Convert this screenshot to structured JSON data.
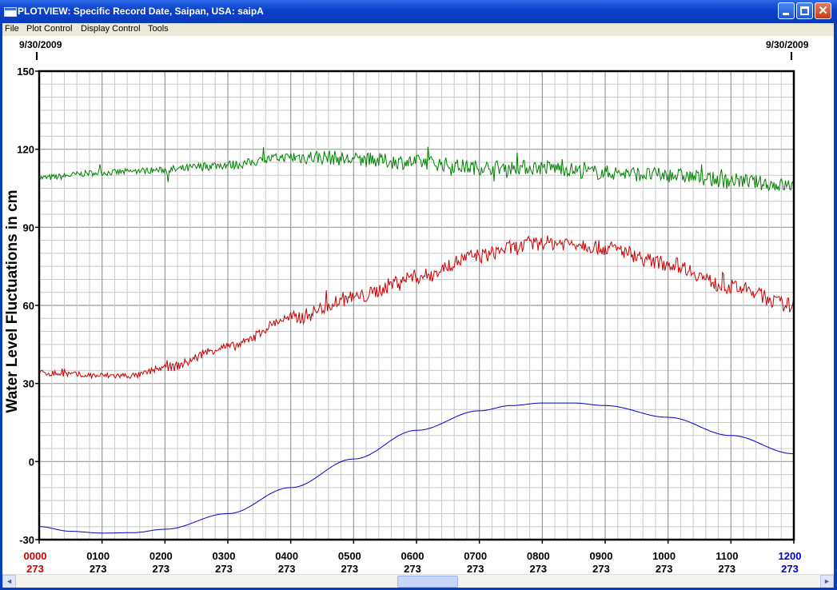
{
  "window": {
    "title": "PLOTVIEW: Specific Record Date, Saipan, USA: saipA",
    "buttons": {
      "minimize": "minimize-icon",
      "maximize": "maximize-icon",
      "close_glyph": "✕"
    }
  },
  "menu": {
    "items": [
      "File",
      "Plot Control",
      "Display Control",
      "Tools"
    ]
  },
  "plot": {
    "start_date": "9/30/2009",
    "end_date": "9/30/2009",
    "ylabel": "Water Level Fluctuations in cm"
  },
  "chart_data": {
    "type": "line",
    "ylabel": "Water Level Fluctuations in cm",
    "xlabel": "",
    "ylim": [
      -30,
      150
    ],
    "yticks": [
      -30,
      0,
      30,
      60,
      90,
      120,
      150
    ],
    "xlim": [
      0,
      12
    ],
    "xtick_labels": [
      "0000",
      "0100",
      "0200",
      "0300",
      "0400",
      "0500",
      "0600",
      "0700",
      "0800",
      "0900",
      "1000",
      "1100",
      "1200"
    ],
    "xtick_day": [
      "273",
      "273",
      "273",
      "273",
      "273",
      "273",
      "273",
      "273",
      "273",
      "273",
      "273",
      "273",
      "273"
    ],
    "xtick_colors": {
      "first": "#cc0000",
      "last": "#0000cc",
      "default": "#000000"
    },
    "grid": true,
    "series": [
      {
        "color": "#008000",
        "noise": 2.2,
        "x": [
          0,
          1,
          2,
          3,
          4,
          4.5,
          5,
          6,
          7,
          8,
          9,
          10,
          11,
          12
        ],
        "y": [
          109,
          111,
          112,
          114,
          117,
          117,
          116,
          115,
          113,
          113,
          111,
          110,
          108,
          106
        ]
      },
      {
        "color": "#cc0000",
        "noise": 2.2,
        "x": [
          0,
          1,
          1.5,
          2,
          3,
          4,
          5,
          6,
          7,
          7.5,
          8,
          8.5,
          9,
          10,
          11,
          12
        ],
        "y": [
          34,
          33,
          33,
          36,
          44,
          55,
          63,
          71,
          79,
          82,
          84,
          84,
          82,
          76,
          67,
          60
        ]
      },
      {
        "color": "#0000cc",
        "noise": 0,
        "x": [
          0,
          0.5,
          1,
          1.5,
          2,
          3,
          4,
          5,
          6,
          7,
          7.5,
          8,
          8.5,
          9,
          10,
          11,
          12
        ],
        "y": [
          -25,
          -26.8,
          -27.5,
          -27.3,
          -26,
          -20,
          -10,
          1,
          12,
          19.5,
          21.5,
          22.5,
          22.5,
          21.5,
          17,
          10,
          3
        ]
      }
    ]
  },
  "scrollbar": {
    "left_arrow": "◄",
    "right_arrow": "►"
  }
}
